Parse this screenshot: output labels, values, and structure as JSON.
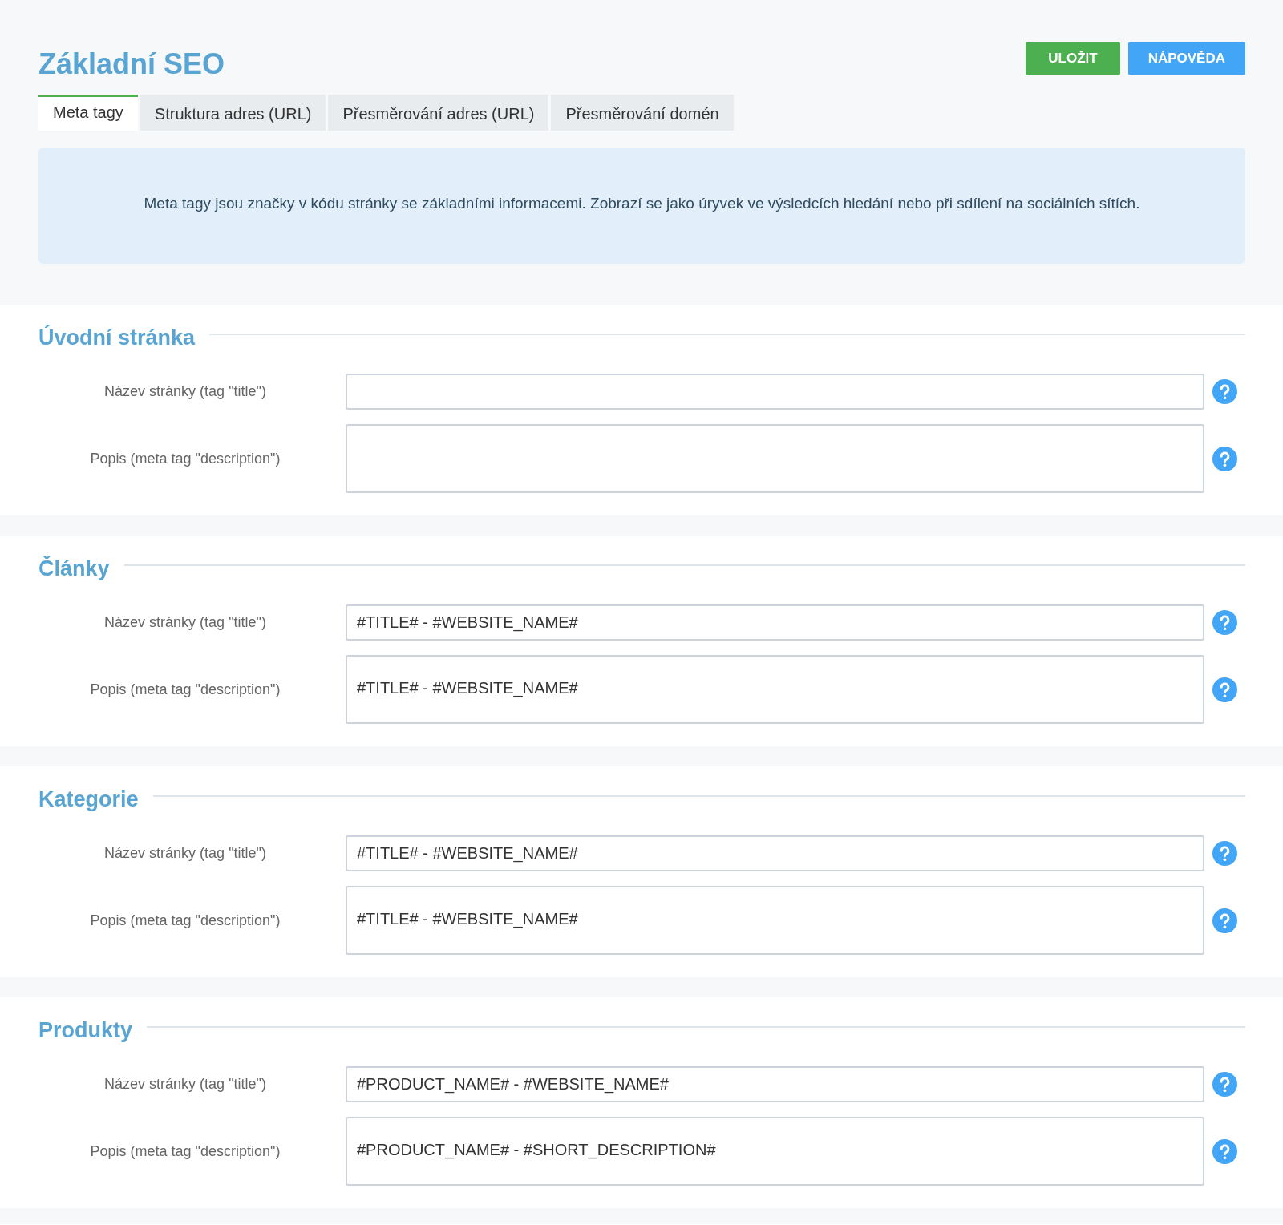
{
  "header": {
    "title": "Základní SEO",
    "buttons": [
      {
        "label": "ULOŽIT",
        "kind": "save"
      },
      {
        "label": "NÁPOVĚDA",
        "kind": "help"
      }
    ]
  },
  "tabs": [
    {
      "label": "Meta tagy",
      "selected": true
    },
    {
      "label": "Struktura adres (URL)",
      "selected": false
    },
    {
      "label": "Přesměrování adres (URL)",
      "selected": false
    },
    {
      "label": "Přesměrování domén",
      "selected": false
    }
  ],
  "info": {
    "text": "Meta tagy jsou značky v kódu stránky se základními informacemi. Zobrazí se jako úryvek ve výsledcích hledání nebo při sdílení na sociálních sítích."
  },
  "sections": [
    {
      "title": "Úvodní stránka",
      "fields": [
        {
          "label": "Název stránky (tag \"title\")",
          "kind": "input"
        },
        {
          "label": "Popis (meta tag \"description\")",
          "kind": "textarea"
        }
      ]
    },
    {
      "title": "Články",
      "fields": [
        {
          "label": "Název stránky (tag \"title\")",
          "kind": "input",
          "value": "#TITLE# - #WEBSITE_NAME#"
        },
        {
          "label": "Popis (meta tag \"description\")",
          "kind": "textarea",
          "value": "#TITLE# - #WEBSITE_NAME#"
        }
      ]
    },
    {
      "title": "Kategorie",
      "fields": [
        {
          "label": "Název stránky (tag \"title\")",
          "kind": "input",
          "value": "#TITLE# - #WEBSITE_NAME#"
        },
        {
          "label": "Popis (meta tag \"description\")",
          "kind": "textarea",
          "value": "#TITLE# - #WEBSITE_NAME#"
        }
      ]
    },
    {
      "title": "Produkty",
      "fields": [
        {
          "label": "Název stránky (tag \"title\")",
          "kind": "input",
          "value": "#PRODUCT_NAME# - #WEBSITE_NAME#"
        },
        {
          "label": "Popis (meta tag \"description\")",
          "kind": "textarea",
          "value": "#PRODUCT_NAME# - #SHORT_DESCRIPTION#"
        }
      ]
    }
  ]
}
